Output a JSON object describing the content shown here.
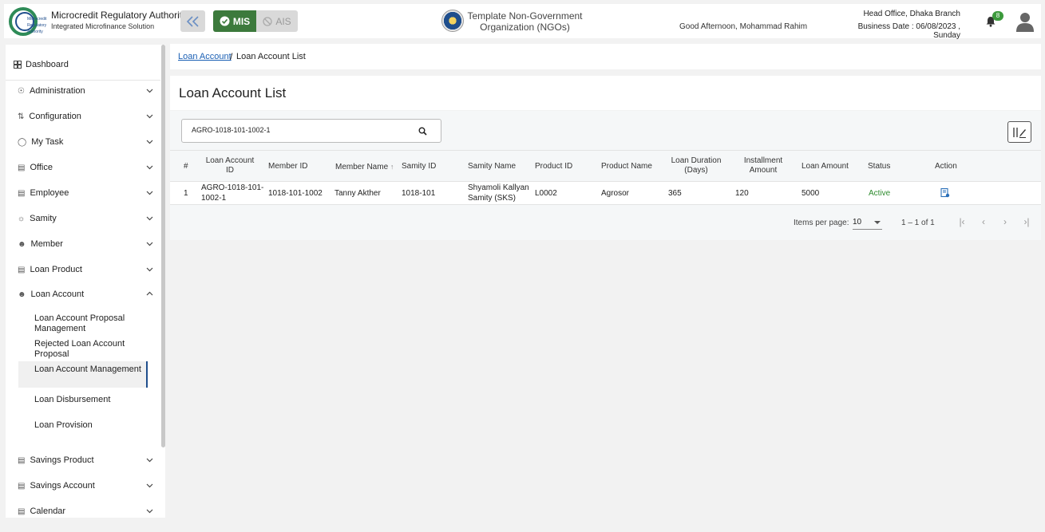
{
  "header": {
    "brand_title": "Microcredit Regulatory Authority",
    "brand_subtitle": "Integrated Microfinance Solution",
    "logo_text": "Microcredit Regulatory Authority",
    "mis_label": "MIS",
    "ais_label": "AIS",
    "org_name": "Template Non-Government Organization (NGOs)",
    "greeting": "Good Afternoon, Mohammad Rahim",
    "branch": "Head Office, Dhaka Branch",
    "business_date": "Business Date : 06/08/2023 , Sunday",
    "notification_count": "8"
  },
  "sidebar": {
    "dashboard": "Dashboard",
    "items": [
      {
        "label": "Administration",
        "icon": "admin-icon"
      },
      {
        "label": "Configuration",
        "icon": "config-icon"
      },
      {
        "label": "My Task",
        "icon": "task-icon"
      },
      {
        "label": "Office",
        "icon": "office-icon"
      },
      {
        "label": "Employee",
        "icon": "employee-icon"
      },
      {
        "label": "Samity",
        "icon": "samity-icon"
      },
      {
        "label": "Member",
        "icon": "member-icon"
      },
      {
        "label": "Loan Product",
        "icon": "loan-product-icon"
      },
      {
        "label": "Loan Account",
        "icon": "loan-account-icon"
      }
    ],
    "loan_account_sub": [
      "Loan Account Proposal Management",
      "Rejected Loan Account Proposal",
      "Loan Account Management",
      "Loan Disbursement",
      "Loan Provision"
    ],
    "bottom_items": [
      {
        "label": "Savings Product"
      },
      {
        "label": "Savings Account"
      },
      {
        "label": "Calendar"
      }
    ]
  },
  "breadcrumb": {
    "parent": "Loan Account",
    "separator": "/",
    "current": "Loan Account List"
  },
  "page": {
    "title": "Loan Account List",
    "search_value": "AGRO-1018-101-1002-1"
  },
  "table": {
    "headers": {
      "index": "#",
      "loan_account_id": "Loan Account ID",
      "member_id": "Member ID",
      "member_name": "Member Name",
      "samity_id": "Samity ID",
      "samity_name": "Samity Name",
      "product_id": "Product ID",
      "product_name": "Product Name",
      "loan_duration": "Loan Duration (Days)",
      "installment_amount": "Installment Amount",
      "loan_amount": "Loan Amount",
      "status": "Status",
      "action": "Action"
    },
    "rows": [
      {
        "index": "1",
        "loan_account_id": "AGRO-1018-101-1002-1",
        "member_id": "1018-101-1002",
        "member_name": "Tanny Akther",
        "samity_id": "1018-101",
        "samity_name": "Shyamoli Kallyan Samity (SKS)",
        "product_id": "L0002",
        "product_name": "Agrosor",
        "loan_duration": "365",
        "installment_amount": "120",
        "loan_amount": "5000",
        "status": "Active"
      }
    ]
  },
  "pager": {
    "items_per_page_label": "Items per page:",
    "items_per_page": "10",
    "range": "1 – 1 of 1"
  },
  "colors": {
    "mis_green": "#3c7a3c",
    "active_status": "#2e8b2e",
    "link_blue": "#1a5fb4",
    "active_indicator": "#1f4e8c"
  }
}
